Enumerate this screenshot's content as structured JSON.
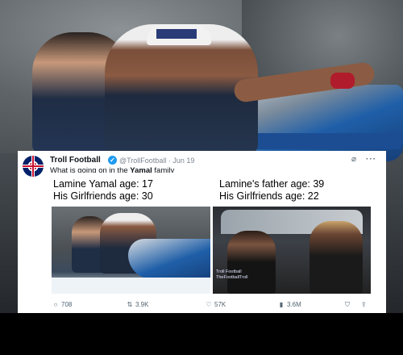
{
  "tweet": {
    "author_name": "Troll Football",
    "author_handle": "@TrollFootball",
    "separator": "·",
    "date": "Jun 19",
    "text_before": "What is going on in the ",
    "text_bold": "Yamal",
    "text_after": " family",
    "header_icons": [
      "grok-icon",
      "more-icon"
    ],
    "meme": {
      "left_line1": "Lamine Yamal age: 17",
      "left_line2": "His Girlfriends age: 30",
      "right_line1": "Lamine's father age: 39",
      "right_line2": "His Girlfriends age: 22",
      "watermark_line1": "Troll Football",
      "watermark_line2": "TheFootballTroll"
    },
    "actions": {
      "replies": "708",
      "reposts": "3.9K",
      "likes": "57K",
      "views": "3.6M"
    }
  },
  "colors": {
    "verified": "#1d9bf0",
    "muted_text": "#536471",
    "jetski_blue": "#1f5fa8"
  }
}
